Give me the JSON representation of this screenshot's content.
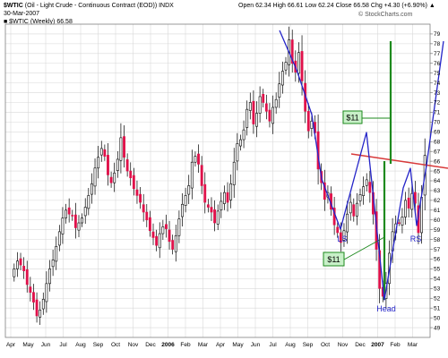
{
  "header": {
    "symbol": "$WTIC",
    "description": "(Oil - Light Crude - Continuous Contract (EOD)) INDX",
    "date": "30-Mar-2007",
    "series_label": "■ $WTIC (Weekly) 66.58",
    "ohlc": "Open 62.34  High 66.61  Low 62.24  Close 66.58  Chg +4.30 (+6.90%) ▲",
    "watermark": "© StockCharts.com"
  },
  "chart_data": {
    "type": "candlestick",
    "ylim": [
      48,
      80
    ],
    "y_ticks": [
      49,
      50,
      51,
      52,
      53,
      54,
      55,
      56,
      57,
      58,
      59,
      60,
      61,
      62,
      63,
      64,
      65,
      66,
      67,
      68,
      69,
      70,
      71,
      72,
      73,
      74,
      75,
      76,
      77,
      78,
      79
    ],
    "x_ticks": [
      {
        "label": "Apr",
        "bold": false
      },
      {
        "label": "May",
        "bold": false
      },
      {
        "label": "Jun",
        "bold": false
      },
      {
        "label": "Jul",
        "bold": false
      },
      {
        "label": "Aug",
        "bold": false
      },
      {
        "label": "Sep",
        "bold": false
      },
      {
        "label": "Oct",
        "bold": false
      },
      {
        "label": "Nov",
        "bold": false
      },
      {
        "label": "Dec",
        "bold": false
      },
      {
        "label": "2006",
        "bold": true
      },
      {
        "label": "Feb",
        "bold": false
      },
      {
        "label": "Mar",
        "bold": false
      },
      {
        "label": "Apr",
        "bold": false
      },
      {
        "label": "May",
        "bold": false
      },
      {
        "label": "Jun",
        "bold": false
      },
      {
        "label": "Jul",
        "bold": false
      },
      {
        "label": "Aug",
        "bold": false
      },
      {
        "label": "Sep",
        "bold": false
      },
      {
        "label": "Oct",
        "bold": false
      },
      {
        "label": "Nov",
        "bold": false
      },
      {
        "label": "Dec",
        "bold": false
      },
      {
        "label": "2007",
        "bold": true
      },
      {
        "label": "Feb",
        "bold": false
      },
      {
        "label": "Mar",
        "bold": false
      }
    ],
    "closes": [
      55.0,
      55.8,
      55.4,
      54.8,
      53.4,
      52.6,
      51.6,
      50.2,
      50.8,
      51.9,
      53.5,
      55.0,
      55.9,
      57.3,
      58.8,
      60.2,
      61.0,
      60.6,
      60.4,
      59.2,
      59.7,
      60.2,
      61.3,
      62.5,
      63.7,
      65.3,
      66.4,
      67.3,
      66.5,
      64.6,
      63.8,
      64.8,
      66.2,
      68.4,
      66.4,
      65.0,
      64.3,
      63.2,
      62.5,
      61.8,
      60.8,
      60.0,
      58.9,
      58.2,
      57.4,
      58.6,
      59.3,
      59.1,
      57.8,
      57.0,
      58.4,
      60.1,
      61.6,
      62.5,
      63.5,
      65.9,
      66.5,
      65.7,
      63.5,
      61.8,
      61.3,
      60.8,
      59.7,
      60.9,
      61.9,
      62.8,
      61.8,
      63.7,
      65.9,
      67.8,
      68.2,
      69.2,
      71.3,
      72.0,
      69.8,
      70.9,
      72.6,
      72.0,
      71.1,
      70.1,
      71.5,
      72.3,
      73.9,
      75.2,
      76.1,
      78.4,
      76.0,
      75.1,
      77.1,
      74.2,
      71.1,
      69.1,
      70.1,
      68.9,
      65.2,
      63.8,
      62.1,
      62.8,
      61.1,
      59.5,
      58.7,
      57.7,
      58.9,
      60.6,
      61.8,
      60.4,
      61.7,
      62.6,
      63.4,
      64.1,
      62.8,
      60.6,
      57.0,
      53.0,
      52.2,
      53.5,
      56.6,
      58.8,
      59.6,
      59.7,
      60.3,
      62.0,
      61.2,
      62.7,
      61.7,
      58.7,
      62.3,
      66.6
    ],
    "ohlc_note": "weekly candlesticks, red = down week, black/white = up week"
  },
  "annotations": {
    "ls": "LS",
    "head": "Head",
    "rs": "RS",
    "box_upper": "$11",
    "box_lower": "$11",
    "colors": {
      "neckline": "#d83a3a",
      "target": "#1e8a1e",
      "pattern": "#2424c8",
      "box_fill": "#c8f0c8",
      "down_candle": "#e0114a",
      "grid": "#d9d9d9"
    }
  }
}
